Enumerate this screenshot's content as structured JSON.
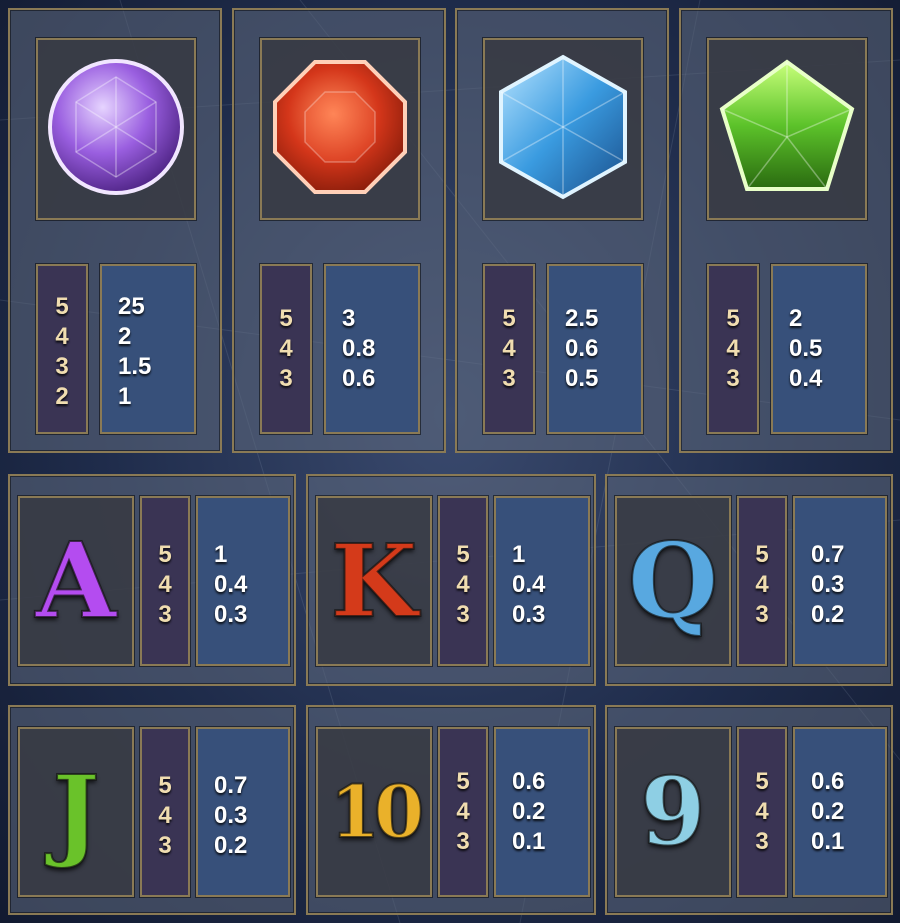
{
  "top_symbols": [
    {
      "symbol_icon": "purple-round-gem-icon",
      "color": "#9a5fe0",
      "counts": [
        "5",
        "4",
        "3",
        "2"
      ],
      "payouts": [
        "25",
        "2",
        "1.5",
        "1"
      ]
    },
    {
      "symbol_icon": "red-octagon-gem-icon",
      "color": "#d4361a",
      "counts": [
        "5",
        "4",
        "3"
      ],
      "payouts": [
        "3",
        "0.8",
        "0.6"
      ]
    },
    {
      "symbol_icon": "blue-hexagon-gem-icon",
      "color": "#3a9be0",
      "counts": [
        "5",
        "4",
        "3"
      ],
      "payouts": [
        "2.5",
        "0.6",
        "0.5"
      ]
    },
    {
      "symbol_icon": "green-pentagon-gem-icon",
      "color": "#5cc22a",
      "counts": [
        "5",
        "4",
        "3"
      ],
      "payouts": [
        "2",
        "0.5",
        "0.4"
      ]
    }
  ],
  "card_symbols": [
    {
      "letter": "A",
      "symbol_icon": "letter-a-icon",
      "color": "#b44cf0",
      "counts": [
        "5",
        "4",
        "3"
      ],
      "payouts": [
        "1",
        "0.4",
        "0.3"
      ]
    },
    {
      "letter": "K",
      "symbol_icon": "letter-k-icon",
      "color": "#d43a1a",
      "counts": [
        "5",
        "4",
        "3"
      ],
      "payouts": [
        "1",
        "0.4",
        "0.3"
      ]
    },
    {
      "letter": "Q",
      "symbol_icon": "letter-q-icon",
      "color": "#58a8e0",
      "counts": [
        "5",
        "4",
        "3"
      ],
      "payouts": [
        "0.7",
        "0.3",
        "0.2"
      ]
    },
    {
      "letter": "J",
      "symbol_icon": "letter-j-icon",
      "color": "#6ac22a",
      "counts": [
        "5",
        "4",
        "3"
      ],
      "payouts": [
        "0.7",
        "0.3",
        "0.2"
      ]
    },
    {
      "letter": "10",
      "symbol_icon": "number-10-icon",
      "color": "#eab12a",
      "counts": [
        "5",
        "4",
        "3"
      ],
      "payouts": [
        "0.6",
        "0.2",
        "0.1"
      ]
    },
    {
      "letter": "9",
      "symbol_icon": "number-9-icon",
      "color": "#8ecfe4",
      "counts": [
        "5",
        "4",
        "3"
      ],
      "payouts": [
        "0.6",
        "0.2",
        "0.1"
      ]
    }
  ]
}
